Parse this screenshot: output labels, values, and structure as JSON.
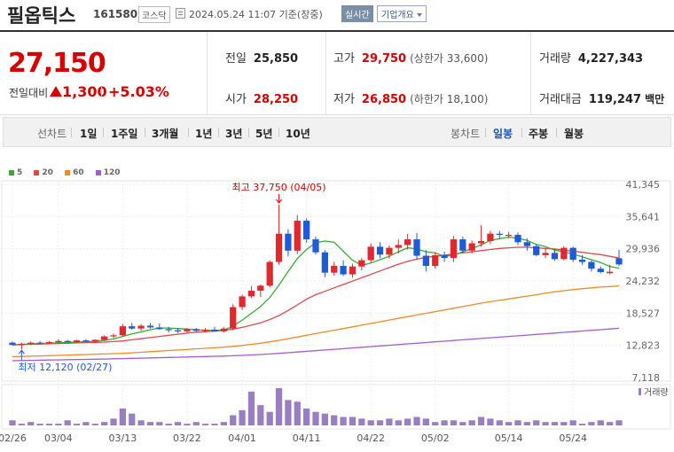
{
  "header": {
    "name": "필옵틱스",
    "code": "161580",
    "market": "코스닥",
    "datetime": "2024.05.24 11:07 기준(장중)",
    "realtime": "실시간",
    "overview": "기업개요"
  },
  "quote": {
    "price": "27,150",
    "change_label": "전일대비",
    "change": "1,300",
    "change_pct": "+5.03%",
    "prev_label": "전일",
    "prev": "25,850",
    "open_label": "시가",
    "open": "28,250",
    "high_label": "고가",
    "high": "29,750",
    "upper_limit": "(상한가 33,600)",
    "low_label": "저가",
    "low": "26,850",
    "lower_limit": "(하한가 18,100)",
    "volume_label": "거래량",
    "volume": "4,227,343",
    "amount_label": "거래대금",
    "amount": "119,247",
    "amount_unit": "백만"
  },
  "periods": {
    "line_label": "선차트",
    "items": [
      "1일",
      "1주일",
      "3개월",
      "1년",
      "3년",
      "5년",
      "10년"
    ],
    "candle_label": "봉차트",
    "candles": [
      "일봉",
      "주봉",
      "월봉"
    ],
    "selected_candle": "일봉"
  },
  "chart_data": {
    "type": "candlestick",
    "legend": [
      {
        "name": "5",
        "color": "#3aaa35"
      },
      {
        "name": "20",
        "color": "#e04848"
      },
      {
        "name": "60",
        "color": "#f08a24"
      },
      {
        "name": "120",
        "color": "#a35bd0"
      }
    ],
    "y_ticks": [
      41345,
      35641,
      29936,
      24232,
      18527,
      12823,
      7118
    ],
    "y_tick_labels": [
      "41,345",
      "35,641",
      "29,936",
      "24,232",
      "18,527",
      "12,823",
      "7,118"
    ],
    "ylim": [
      7118,
      41345
    ],
    "x_tick_labels": [
      "02/26",
      "03/04",
      "03/13",
      "03/22",
      "04/01",
      "04/11",
      "04/22",
      "05/02",
      "05/14",
      "05/24"
    ],
    "x_tick_index": [
      0,
      5,
      12,
      19,
      25,
      32,
      39,
      46,
      54,
      61
    ],
    "max_annotation": "최고 37,750 (04/05)",
    "min_annotation": "최저 12,120 (02/27)",
    "max_index": 29,
    "min_index": 1,
    "volume_label": "거래량",
    "candles": [
      [
        13300,
        13500,
        12800,
        12900
      ],
      [
        12900,
        13300,
        12120,
        13100
      ],
      [
        13100,
        13500,
        12900,
        13300
      ],
      [
        13300,
        13600,
        13000,
        13200
      ],
      [
        13200,
        13600,
        13000,
        13400
      ],
      [
        13400,
        13900,
        13200,
        13600
      ],
      [
        13600,
        13800,
        13300,
        13400
      ],
      [
        13400,
        13800,
        13200,
        13700
      ],
      [
        13700,
        13900,
        13400,
        13500
      ],
      [
        13500,
        13900,
        13300,
        13800
      ],
      [
        13800,
        14600,
        13600,
        14400
      ],
      [
        14400,
        14900,
        14100,
        14600
      ],
      [
        14600,
        16600,
        14400,
        16200
      ],
      [
        16200,
        16800,
        15600,
        15800
      ],
      [
        15800,
        16600,
        15400,
        16300
      ],
      [
        16300,
        16800,
        15800,
        16000
      ],
      [
        16000,
        16700,
        15600,
        15700
      ],
      [
        15700,
        16100,
        15100,
        15500
      ],
      [
        15500,
        15900,
        15000,
        15300
      ],
      [
        15300,
        15900,
        15100,
        15700
      ],
      [
        15700,
        15900,
        15200,
        15400
      ],
      [
        15400,
        15900,
        15100,
        15600
      ],
      [
        15600,
        16100,
        15200,
        15300
      ],
      [
        15300,
        16000,
        15100,
        15800
      ],
      [
        15800,
        20100,
        15500,
        19600
      ],
      [
        19600,
        21800,
        19100,
        21500
      ],
      [
        21500,
        23300,
        21200,
        22500
      ],
      [
        22500,
        23600,
        21400,
        23400
      ],
      [
        23400,
        27900,
        23100,
        27600
      ],
      [
        27600,
        37750,
        27100,
        32600
      ],
      [
        32600,
        33400,
        28600,
        29600
      ],
      [
        29600,
        35900,
        29000,
        34900
      ],
      [
        34900,
        35300,
        31000,
        31600
      ],
      [
        31600,
        32100,
        28900,
        29300
      ],
      [
        29300,
        29700,
        24900,
        25700
      ],
      [
        25700,
        27600,
        25200,
        26900
      ],
      [
        26900,
        27900,
        25100,
        25400
      ],
      [
        25400,
        27300,
        24800,
        26800
      ],
      [
        26800,
        28300,
        26100,
        27900
      ],
      [
        27900,
        30900,
        27400,
        30300
      ],
      [
        30300,
        31100,
        28300,
        28900
      ],
      [
        28900,
        30500,
        28200,
        30100
      ],
      [
        30100,
        31600,
        29100,
        30600
      ],
      [
        30600,
        32600,
        29800,
        31600
      ],
      [
        31600,
        32700,
        28100,
        28700
      ],
      [
        28700,
        29700,
        25900,
        26900
      ],
      [
        26900,
        29300,
        26400,
        28800
      ],
      [
        28800,
        29400,
        27600,
        28300
      ],
      [
        28300,
        32200,
        27600,
        31600
      ],
      [
        31600,
        32100,
        29100,
        29600
      ],
      [
        29600,
        31400,
        29100,
        30900
      ],
      [
        30900,
        34100,
        30300,
        31300
      ],
      [
        31300,
        33100,
        30800,
        32600
      ],
      [
        32600,
        33100,
        31600,
        32400
      ],
      [
        32400,
        32900,
        31800,
        32400
      ],
      [
        32400,
        32800,
        30600,
        31100
      ],
      [
        31100,
        31800,
        29600,
        30400
      ],
      [
        30400,
        30800,
        28600,
        28800
      ],
      [
        28800,
        30100,
        28300,
        29200
      ],
      [
        29200,
        29900,
        27800,
        28100
      ],
      [
        28100,
        30400,
        27900,
        30100
      ],
      [
        30100,
        30300,
        27600,
        28000
      ],
      [
        28000,
        28800,
        27100,
        27600
      ],
      [
        27600,
        27900,
        25900,
        26400
      ],
      [
        26400,
        26800,
        25600,
        25800
      ],
      [
        25600,
        27100,
        25400,
        25850
      ],
      [
        28250,
        29750,
        26850,
        27150
      ]
    ],
    "ma": {
      "5": [
        12900,
        13000,
        13100,
        13150,
        13200,
        13300,
        13350,
        13400,
        13450,
        13550,
        13700,
        13950,
        14400,
        14850,
        15200,
        15600,
        15900,
        15900,
        15800,
        15700,
        15600,
        15500,
        15500,
        15500,
        16200,
        17300,
        18500,
        19700,
        21300,
        23500,
        25900,
        28200,
        29800,
        31000,
        31300,
        31100,
        29500,
        27900,
        27000,
        27400,
        28000,
        28600,
        29400,
        30100,
        29900,
        29400,
        29200,
        28600,
        28800,
        29400,
        30000,
        30600,
        31400,
        31700,
        32000,
        31800,
        31400,
        30700,
        30300,
        29700,
        29400,
        29000,
        28500,
        28000,
        27500,
        26800,
        26500
      ],
      "20": [
        12900,
        12950,
        13000,
        13050,
        13100,
        13150,
        13200,
        13250,
        13300,
        13350,
        13400,
        13500,
        13600,
        13800,
        14000,
        14200,
        14400,
        14600,
        14800,
        15000,
        15150,
        15250,
        15350,
        15450,
        15700,
        16000,
        16400,
        16800,
        17400,
        18100,
        19000,
        20000,
        21000,
        21800,
        22400,
        23000,
        23600,
        24200,
        24800,
        25400,
        26000,
        26600,
        27200,
        27700,
        28100,
        28400,
        28600,
        28800,
        29000,
        29200,
        29400,
        29600,
        29800,
        30000,
        30100,
        30200,
        30200,
        30100,
        30000,
        29900,
        29700,
        29500,
        29300,
        29100,
        28900,
        28600,
        28300
      ],
      "60": [
        10800,
        10850,
        10900,
        10950,
        11000,
        11050,
        11100,
        11150,
        11200,
        11250,
        11300,
        11350,
        11400,
        11500,
        11600,
        11700,
        11800,
        11900,
        12000,
        12100,
        12200,
        12300,
        12400,
        12500,
        12650,
        12800,
        13000,
        13200,
        13450,
        13700,
        14000,
        14300,
        14600,
        14900,
        15200,
        15500,
        15800,
        16100,
        16400,
        16700,
        17000,
        17300,
        17600,
        17900,
        18200,
        18500,
        18800,
        19100,
        19400,
        19700,
        20000,
        20300,
        20550,
        20800,
        21050,
        21300,
        21550,
        21800,
        22050,
        22300,
        22500,
        22700,
        22850,
        23000,
        23150,
        23250,
        23350
      ],
      "120": [
        10100,
        10130,
        10160,
        10190,
        10220,
        10250,
        10280,
        10310,
        10340,
        10370,
        10400,
        10440,
        10480,
        10520,
        10560,
        10600,
        10640,
        10680,
        10720,
        10760,
        10800,
        10840,
        10880,
        10920,
        10980,
        11040,
        11120,
        11200,
        11300,
        11400,
        11520,
        11640,
        11760,
        11880,
        12000,
        12120,
        12240,
        12360,
        12480,
        12600,
        12720,
        12840,
        12960,
        13080,
        13200,
        13320,
        13440,
        13560,
        13680,
        13800,
        13920,
        14040,
        14160,
        14280,
        14400,
        14520,
        14640,
        14760,
        14880,
        15000,
        15120,
        15240,
        15360,
        15480,
        15600,
        15720,
        15840
      ]
    },
    "volume": [
      3,
      1,
      2,
      1,
      1,
      1,
      3,
      1,
      2,
      1,
      2,
      4,
      10,
      7,
      3,
      2,
      2,
      1,
      2,
      1,
      2,
      1,
      1,
      2,
      6,
      9,
      20,
      12,
      8,
      22,
      15,
      14,
      10,
      8,
      7,
      6,
      5,
      5,
      4,
      3,
      3,
      4,
      3,
      4,
      5,
      4,
      2,
      3,
      3,
      2,
      3,
      5,
      4,
      3,
      2,
      3,
      2,
      3,
      2,
      2,
      2,
      3,
      1,
      2,
      3,
      2,
      3
    ]
  }
}
